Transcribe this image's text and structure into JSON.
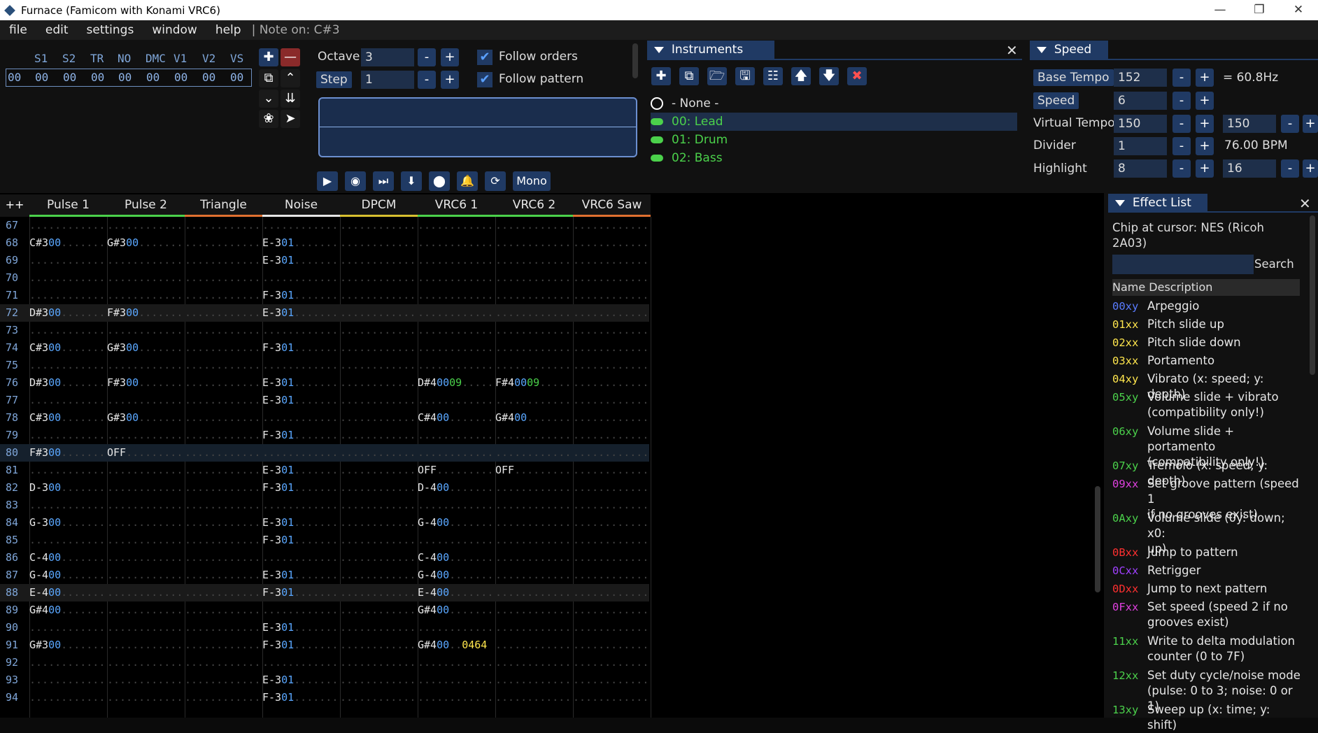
{
  "window": {
    "title": "Furnace (Famicom with Konami VRC6)"
  },
  "menu": {
    "items": [
      "file",
      "edit",
      "settings",
      "window",
      "help"
    ],
    "status": "| Note on: C#3"
  },
  "channels_short": [
    "S1",
    "S2",
    "TR",
    "NO",
    "DMC",
    "V1",
    "V2",
    "VS"
  ],
  "volumes": [
    "00",
    "00",
    "00",
    "00",
    "00",
    "00",
    "00",
    "00",
    "00"
  ],
  "octave": {
    "label": "Octave",
    "value": "3"
  },
  "step": {
    "label": "Step",
    "value": "1"
  },
  "follow": {
    "orders": "Follow orders",
    "pattern": "Follow pattern"
  },
  "mono": "Mono",
  "instruments": {
    "title": "Instruments",
    "none": "- None -",
    "items": [
      "00: Lead",
      "01: Drum",
      "02: Bass"
    ]
  },
  "speed": {
    "title": "Speed",
    "base_tempo": {
      "label": "Base Tempo",
      "value": "152",
      "hz": "= 60.8Hz"
    },
    "speed": {
      "label": "Speed",
      "value": "6"
    },
    "virtual_tempo": {
      "label": "Virtual Tempo",
      "v1": "150",
      "v2": "150"
    },
    "divider": {
      "label": "Divider",
      "value": "1",
      "bpm": "76.00 BPM"
    },
    "highlight": {
      "label": "Highlight",
      "v1": "8",
      "v2": "16"
    }
  },
  "pattern": {
    "corner": "++",
    "channels": [
      {
        "name": "Pulse 1",
        "color": "#4bd14b"
      },
      {
        "name": "Pulse 2",
        "color": "#4bd14b"
      },
      {
        "name": "Triangle",
        "color": "#e07030"
      },
      {
        "name": "Noise",
        "color": "#e6e6e6"
      },
      {
        "name": "DPCM",
        "color": "#d8c030"
      },
      {
        "name": "VRC6 1",
        "color": "#4bd14b"
      },
      {
        "name": "VRC6 2",
        "color": "#4bd14b"
      },
      {
        "name": "VRC6 Saw",
        "color": "#e07030"
      }
    ],
    "rows": [
      {
        "n": "67",
        "cells": []
      },
      {
        "n": "68",
        "cells": [
          [
            "C#3",
            "00"
          ],
          [
            "G#3",
            "00"
          ],
          null,
          [
            "E-3",
            "01"
          ]
        ]
      },
      {
        "n": "69",
        "cells": [
          null,
          null,
          null,
          [
            "E-3",
            "01"
          ]
        ]
      },
      {
        "n": "70",
        "cells": []
      },
      {
        "n": "71",
        "cells": [
          null,
          null,
          null,
          [
            "F-3",
            "01"
          ]
        ]
      },
      {
        "n": "72",
        "hl": 1,
        "cells": [
          [
            "D#3",
            "00"
          ],
          [
            "F#3",
            "00"
          ],
          null,
          [
            "E-3",
            "01"
          ]
        ]
      },
      {
        "n": "73",
        "cells": []
      },
      {
        "n": "74",
        "cells": [
          [
            "C#3",
            "00"
          ],
          [
            "G#3",
            "00"
          ],
          null,
          [
            "F-3",
            "01"
          ]
        ]
      },
      {
        "n": "75",
        "cells": []
      },
      {
        "n": "76",
        "cells": [
          [
            "D#3",
            "00"
          ],
          [
            "F#3",
            "00"
          ],
          null,
          [
            "E-3",
            "01"
          ],
          null,
          [
            "D#4",
            "00",
            "09"
          ],
          [
            "F#4",
            "00",
            "09"
          ]
        ]
      },
      {
        "n": "77",
        "cells": [
          null,
          null,
          null,
          [
            "E-3",
            "01"
          ]
        ]
      },
      {
        "n": "78",
        "cells": [
          [
            "C#3",
            "00"
          ],
          [
            "G#3",
            "00"
          ],
          null,
          null,
          null,
          [
            "C#4",
            "00"
          ],
          [
            "G#4",
            "00"
          ]
        ]
      },
      {
        "n": "79",
        "cells": [
          null,
          null,
          null,
          [
            "F-3",
            "01"
          ]
        ]
      },
      {
        "n": "80",
        "hl": 2,
        "cells": [
          [
            "F#3",
            "00"
          ],
          [
            "OFF"
          ]
        ]
      },
      {
        "n": "81",
        "cells": [
          null,
          null,
          null,
          [
            "E-3",
            "01"
          ],
          null,
          [
            "OFF"
          ],
          [
            "OFF"
          ]
        ]
      },
      {
        "n": "82",
        "cells": [
          [
            "D-3",
            "00"
          ],
          null,
          null,
          [
            "F-3",
            "01"
          ],
          null,
          [
            "D-4",
            "00"
          ]
        ]
      },
      {
        "n": "83",
        "cells": []
      },
      {
        "n": "84",
        "cells": [
          [
            "G-3",
            "00"
          ],
          null,
          null,
          [
            "E-3",
            "01"
          ],
          null,
          [
            "G-4",
            "00"
          ]
        ]
      },
      {
        "n": "85",
        "cells": [
          null,
          null,
          null,
          [
            "F-3",
            "01"
          ]
        ]
      },
      {
        "n": "86",
        "cells": [
          [
            "C-4",
            "00"
          ],
          null,
          null,
          null,
          null,
          [
            "C-4",
            "00"
          ]
        ]
      },
      {
        "n": "87",
        "cells": [
          [
            "G-4",
            "00"
          ],
          null,
          null,
          [
            "E-3",
            "01"
          ],
          null,
          [
            "G-4",
            "00"
          ]
        ]
      },
      {
        "n": "88",
        "hl": 1,
        "cells": [
          [
            "E-4",
            "00"
          ],
          null,
          null,
          [
            "F-3",
            "01"
          ],
          null,
          [
            "E-4",
            "00"
          ]
        ]
      },
      {
        "n": "89",
        "cells": [
          [
            "G#4",
            "00"
          ],
          null,
          null,
          null,
          null,
          [
            "G#4",
            "00"
          ]
        ]
      },
      {
        "n": "90",
        "cells": [
          null,
          null,
          null,
          [
            "E-3",
            "01"
          ]
        ]
      },
      {
        "n": "91",
        "cells": [
          [
            "G#3",
            "00"
          ],
          null,
          null,
          [
            "F-3",
            "01"
          ],
          null,
          [
            "G#4",
            "00",
            "",
            "0464"
          ]
        ]
      },
      {
        "n": "92",
        "cells": []
      },
      {
        "n": "93",
        "cells": [
          null,
          null,
          null,
          [
            "E-3",
            "01"
          ]
        ]
      },
      {
        "n": "94",
        "cells": [
          null,
          null,
          null,
          [
            "F-3",
            "01"
          ]
        ]
      }
    ]
  },
  "effects": {
    "title": "Effect List",
    "chip_l1": "Chip at cursor: NES (Ricoh",
    "chip_l2": "2A03)",
    "search": "Search",
    "col_header": "Name Description",
    "items": [
      {
        "code": "00xy",
        "color": "#5a7cff",
        "d1": "Arpeggio"
      },
      {
        "code": "01xx",
        "color": "#ffe64d",
        "d1": "Pitch slide up"
      },
      {
        "code": "02xx",
        "color": "#ffe64d",
        "d1": "Pitch slide down"
      },
      {
        "code": "03xx",
        "color": "#ffe64d",
        "d1": "Portamento"
      },
      {
        "code": "04xy",
        "color": "#ffe64d",
        "d1": "Vibrato (x: speed; y: depth)"
      },
      {
        "code": "05xy",
        "color": "#4bd14b",
        "d1": "Volume slide + vibrato",
        "d2": "(compatibility only!)"
      },
      {
        "code": "06xy",
        "color": "#4bd14b",
        "d1": "Volume slide + portamento",
        "d2": "(compatibility only!)"
      },
      {
        "code": "07xy",
        "color": "#4bd14b",
        "d1": "Tremolo (x: speed; y: depth)"
      },
      {
        "code": "09xx",
        "color": "#e040e0",
        "d1": "Set groove pattern (speed 1",
        "d2": "if no grooves exist)"
      },
      {
        "code": "0Axy",
        "color": "#4bd14b",
        "d1": "Volume slide (0y: down; x0:",
        "d2": "up)"
      },
      {
        "code": "0Bxx",
        "color": "#ff3030",
        "d1": "Jump to pattern"
      },
      {
        "code": "0Cxx",
        "color": "#a040ff",
        "d1": "Retrigger"
      },
      {
        "code": "0Dxx",
        "color": "#ff3030",
        "d1": "Jump to next pattern"
      },
      {
        "code": "0Fxx",
        "color": "#e040e0",
        "d1": "Set speed (speed 2 if no",
        "d2": "grooves exist)"
      },
      {
        "code": "11xx",
        "color": "#4bd14b",
        "d1": "Write to delta modulation",
        "d2": "counter (0 to 7F)"
      },
      {
        "code": "12xx",
        "color": "#4bd14b",
        "d1": "Set duty cycle/noise mode",
        "d2": "(pulse: 0 to 3; noise: 0 or 1)"
      },
      {
        "code": "13xy",
        "color": "#4bd14b",
        "d1": "Sweep up (x: time; y: shift)"
      }
    ]
  }
}
